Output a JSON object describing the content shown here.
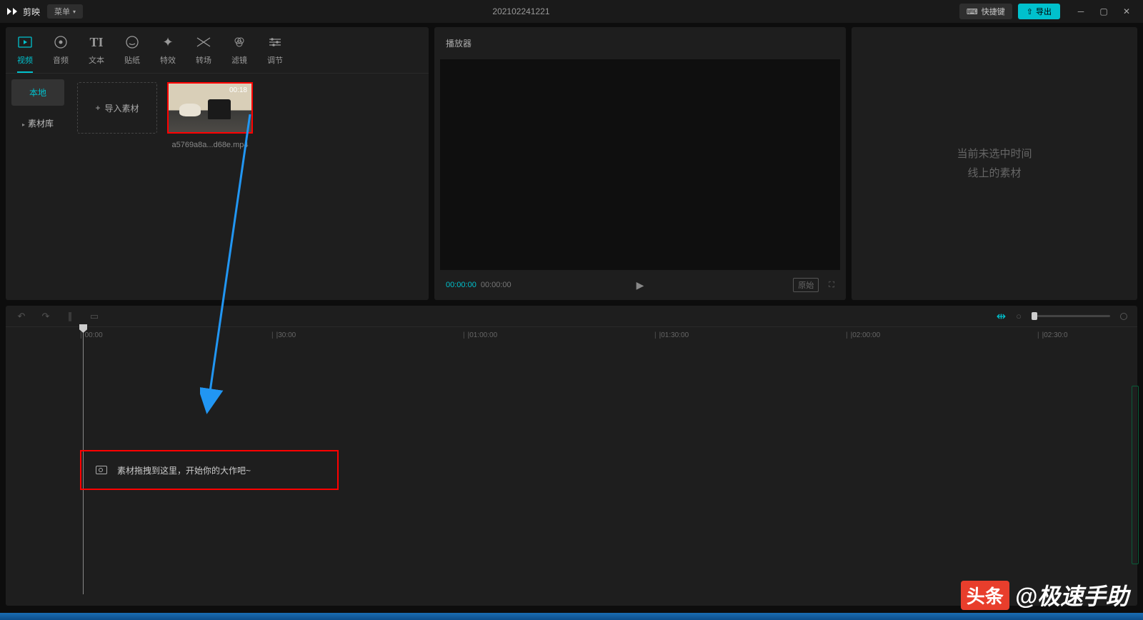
{
  "titlebar": {
    "app_name": "剪映",
    "menu_label": "菜单",
    "project_title": "202102241221",
    "hotkey_label": "快捷键",
    "export_label": "导出"
  },
  "tool_tabs": [
    {
      "label": "视频",
      "active": true
    },
    {
      "label": "音频",
      "active": false
    },
    {
      "label": "文本",
      "active": false
    },
    {
      "label": "贴纸",
      "active": false
    },
    {
      "label": "特效",
      "active": false
    },
    {
      "label": "转场",
      "active": false
    },
    {
      "label": "滤镜",
      "active": false
    },
    {
      "label": "调节",
      "active": false
    }
  ],
  "media_side": {
    "local": "本地",
    "library": "素材库"
  },
  "media": {
    "import_label": "导入素材",
    "clip": {
      "duration": "00:18",
      "filename": "a5769a8a...d68e.mp4"
    }
  },
  "player": {
    "header": "播放器",
    "time_current": "00:00:00",
    "time_total": "00:00:00",
    "ratio_label": "原始"
  },
  "inspector": {
    "empty_line1": "当前未选中时间",
    "empty_line2": "线上的素材"
  },
  "timeline": {
    "ruler": [
      "00:00",
      "|30:00",
      "|01:00:00",
      "|01:30:00",
      "|02:00:00",
      "|02:30:0"
    ],
    "drop_hint": "素材拖拽到这里，开始你的大作吧~"
  },
  "watermark": {
    "logo": "头条",
    "text": "@极速手助"
  }
}
